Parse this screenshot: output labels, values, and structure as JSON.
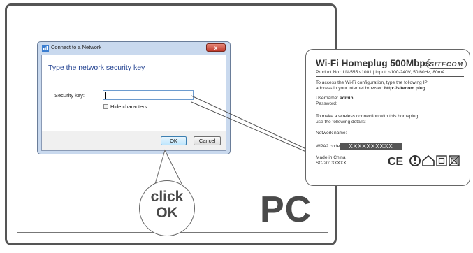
{
  "dialog": {
    "title": "Connect to a Network",
    "close_label": "x",
    "heading": "Type the network security key",
    "key_label": "Security key:",
    "hide_label": "Hide characters",
    "ok_label": "OK",
    "cancel_label": "Cancel"
  },
  "callout": {
    "click_line1": "click",
    "click_line2": "OK"
  },
  "pc_label": "PC",
  "card": {
    "title": "Wi-Fi Homeplug 500Mbps",
    "brand": "SITECOM",
    "product_line": "Product No.: LN-555 v1001 | Input: ~100-240V, 50/60Hz, 80mA",
    "config_line1": "To access the Wi-Fi configuration, type the following IP",
    "config_line2_prefix": "address in your internet browser: ",
    "config_url": "http://sitecom.plug",
    "username_prefix": "Username: ",
    "username": "admin",
    "password_label": "Password:",
    "wireless_line1": "To make a wireless connection with this homeplug,",
    "wireless_line2": "use the following details:",
    "network_name_label": "Network name:",
    "wpa_label": "WPA2 code:",
    "wpa_value": "XXXXXXXXXX",
    "made_in": "Made in China",
    "serial": "SC-2013XXXX",
    "ce_mark": "CE"
  },
  "colors": {
    "title_blue": "#1f3f8f",
    "frame_gray": "#555555",
    "close_red": "#c0392b"
  },
  "icons": [
    "network-icon",
    "close-icon",
    "ce-mark-icon",
    "warning-icon",
    "house-icon",
    "double-insulation-icon",
    "weee-bin-icon"
  ]
}
